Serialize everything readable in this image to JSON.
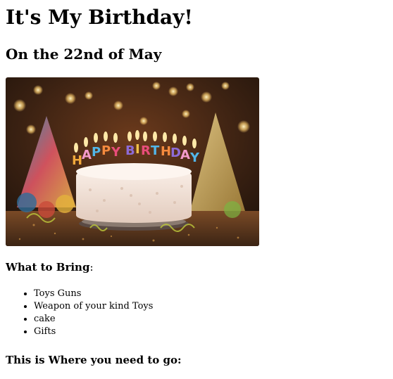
{
  "heading": {
    "title": "It's My Birthday!",
    "date_line": "On the 22nd of May"
  },
  "image": {
    "subject": "birthday-cake-with-candles",
    "candle_letters": [
      "H",
      "A",
      "P",
      "P",
      "Y",
      " ",
      "B",
      "I",
      "R",
      "T",
      "H",
      "D",
      "A",
      "Y"
    ],
    "colors": {
      "background_dark": "#2a1a10",
      "bokeh_light": "#f7c96b",
      "frosting": "#f3e6dc",
      "plate": "#8a7a70"
    }
  },
  "bring": {
    "label": "What to Bring",
    "colon": ":",
    "items": [
      "Toys Guns",
      "Weapon of your kind Toys",
      "cake",
      "Gifts"
    ]
  },
  "where": {
    "label": "This is Where you need to go:"
  }
}
